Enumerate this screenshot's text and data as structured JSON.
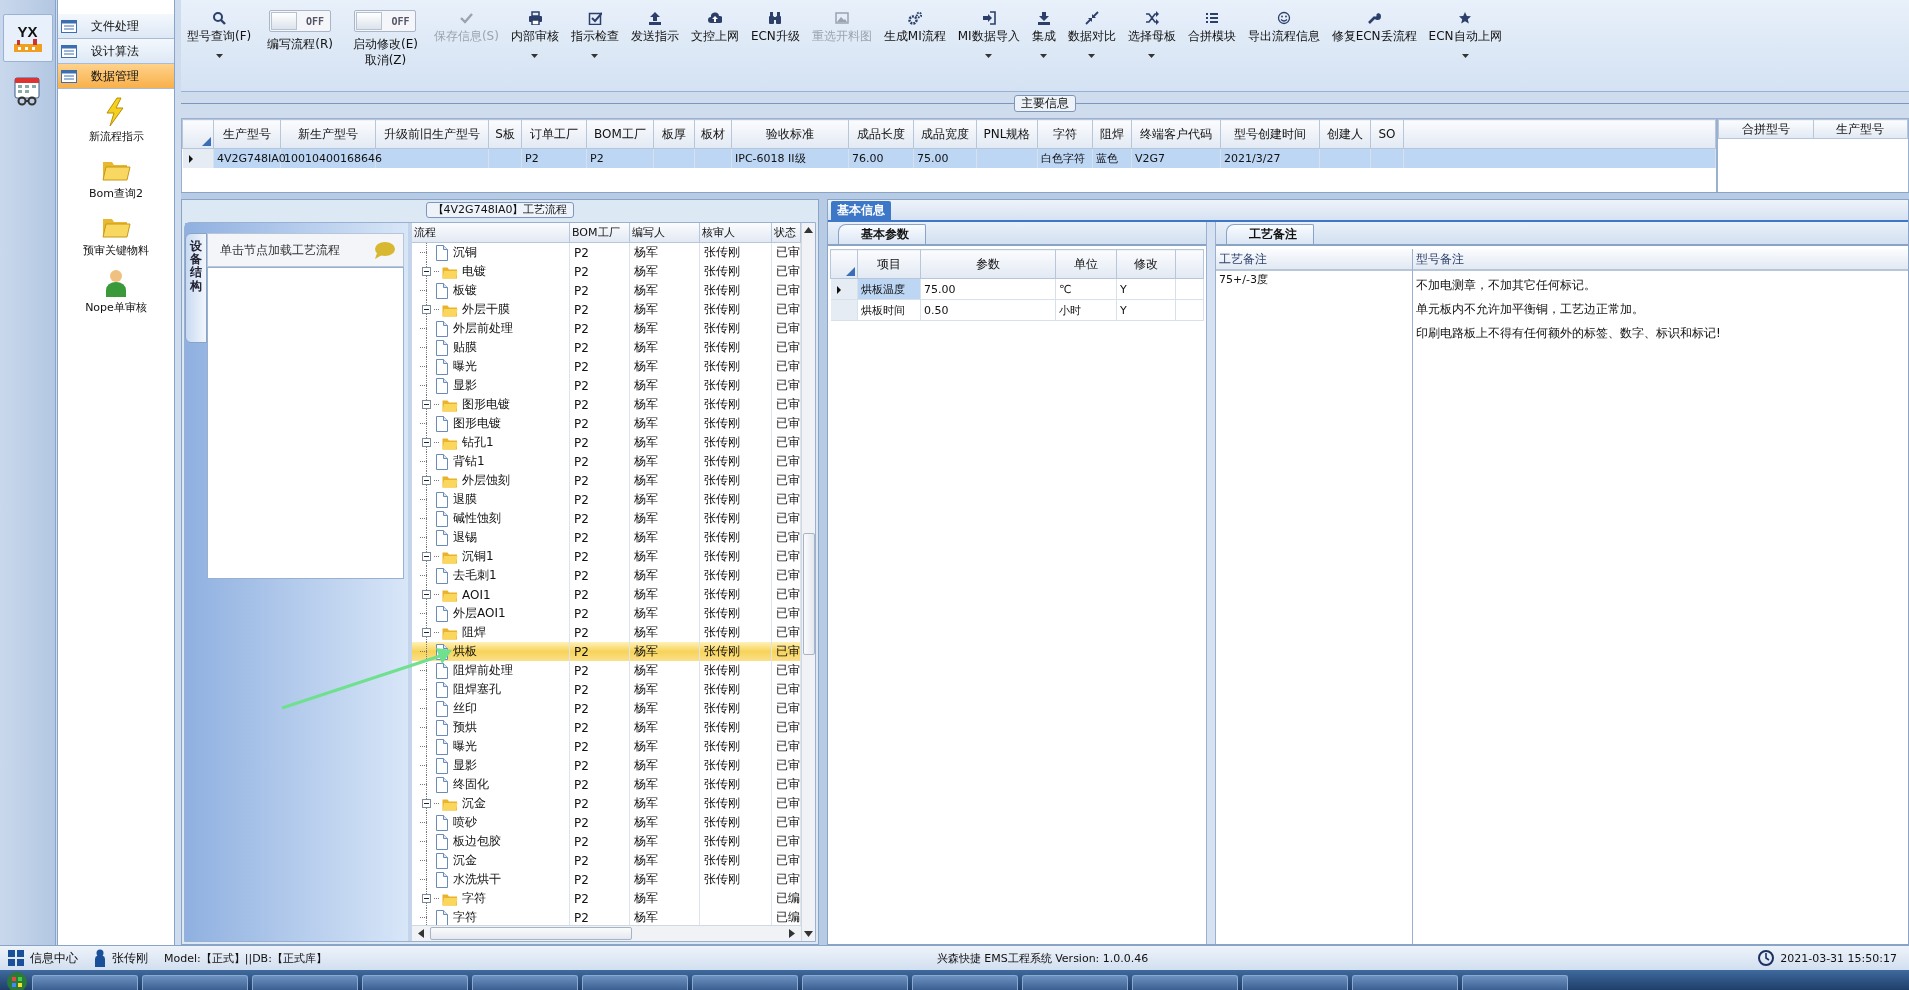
{
  "rail": [
    {
      "kind": "logo",
      "text": "YX",
      "selected": true
    },
    {
      "kind": "calendar",
      "selected": false
    }
  ],
  "nav": {
    "items": [
      {
        "label": "文件处理",
        "selected": false
      },
      {
        "label": "设计算法",
        "selected": false
      },
      {
        "label": "数据管理",
        "selected": true
      }
    ],
    "shortcuts": [
      {
        "label": "新流程指示"
      },
      {
        "label": "Bom查询2"
      },
      {
        "label": "预审关键物料"
      },
      {
        "label": "Nope单审核"
      }
    ]
  },
  "toolbar": [
    {
      "kind": "button",
      "label": "型号查询(F)",
      "dropdown": true,
      "disabled": false
    },
    {
      "kind": "toggle",
      "state_text": "OFF",
      "on": false,
      "label": "编写流程(R)"
    },
    {
      "kind": "toggle",
      "state_text": "OFF",
      "on": false,
      "label": "启动修改(E)",
      "label_2": "取消(Z)"
    },
    {
      "kind": "button",
      "label": "保存信息(S)",
      "dropdown": false,
      "disabled": true
    },
    {
      "kind": "button",
      "label": "内部审核",
      "dropdown": true,
      "disabled": false
    },
    {
      "kind": "button",
      "label": "指示检查",
      "dropdown": true,
      "disabled": false
    },
    {
      "kind": "button",
      "label": "发送指示",
      "dropdown": false,
      "disabled": false
    },
    {
      "kind": "button",
      "label": "文控上网",
      "dropdown": false,
      "disabled": false
    },
    {
      "kind": "button",
      "label": "ECN升级",
      "dropdown": false,
      "disabled": false
    },
    {
      "kind": "button",
      "label": "重选开料图",
      "dropdown": false,
      "disabled": true
    },
    {
      "kind": "button",
      "label": "生成MI流程",
      "dropdown": false,
      "disabled": false
    },
    {
      "kind": "button",
      "label": "MI数据导入",
      "dropdown": true,
      "disabled": false
    },
    {
      "kind": "button",
      "label": "集成",
      "dropdown": true,
      "disabled": false
    },
    {
      "kind": "button",
      "label": "数据对比",
      "dropdown": true,
      "disabled": false
    },
    {
      "kind": "button",
      "label": "选择母板",
      "dropdown": true,
      "disabled": false
    },
    {
      "kind": "button",
      "label": "合拼模块",
      "dropdown": false,
      "disabled": false
    },
    {
      "kind": "button",
      "label": "导出流程信息",
      "dropdown": false,
      "disabled": false
    },
    {
      "kind": "button",
      "label": "修复ECN丢流程",
      "dropdown": false,
      "disabled": false
    },
    {
      "kind": "button",
      "label": "ECN自动上网",
      "dropdown": true,
      "disabled": false
    }
  ],
  "main_info": {
    "title": "主要信息",
    "columns": [
      "生产型号",
      "新生产型号",
      "升级前旧生产型号",
      "S板",
      "订单工厂",
      "BOM工厂",
      "板厚",
      "板材",
      "验收标准",
      "成品长度",
      "成品宽度",
      "PNL规格",
      "字符",
      "阻焊",
      "终端客户代码",
      "型号创建时间",
      "创建人",
      "SO"
    ],
    "rows": [
      {
        "selected": true,
        "cells": [
          "4V2G748IA0",
          "10010400168646",
          null,
          null,
          "P2",
          "P2",
          null,
          null,
          "IPC-6018 II级",
          "76.00",
          "75.00",
          null,
          "白色字符",
          "蓝色",
          "V2G7",
          "2021/3/27",
          null,
          null
        ]
      }
    ],
    "merge_columns": [
      "合拼型号",
      "生产型号"
    ]
  },
  "process": {
    "title": "【4V2G748IA0】工艺流程",
    "side_tab": "设备结构",
    "hint": "单击节点加载工艺流程",
    "columns": [
      "流程",
      "BOM工厂",
      "编写人",
      "核审人",
      "状态"
    ],
    "tree": [
      {
        "kind": "file",
        "label": "沉铜",
        "bom": "P2",
        "writer": "杨军",
        "reviewer": "张传刚",
        "status": "已审",
        "selected": false
      },
      {
        "kind": "folder",
        "label": "电镀",
        "bom": "P2",
        "writer": "杨军",
        "reviewer": "张传刚",
        "status": "已审",
        "selected": false,
        "expanded": true,
        "children": [
          {
            "kind": "file",
            "label": "板镀",
            "bom": "P2",
            "writer": "杨军",
            "reviewer": "张传刚",
            "status": "已审",
            "selected": false
          }
        ]
      },
      {
        "kind": "folder",
        "label": "外层干膜",
        "bom": "P2",
        "writer": "杨军",
        "reviewer": "张传刚",
        "status": "已审",
        "selected": false,
        "expanded": true,
        "children": [
          {
            "kind": "file",
            "label": "外层前处理",
            "bom": "P2",
            "writer": "杨军",
            "reviewer": "张传刚",
            "status": "已审",
            "selected": false
          },
          {
            "kind": "file",
            "label": "贴膜",
            "bom": "P2",
            "writer": "杨军",
            "reviewer": "张传刚",
            "status": "已审",
            "selected": false
          },
          {
            "kind": "file",
            "label": "曝光",
            "bom": "P2",
            "writer": "杨军",
            "reviewer": "张传刚",
            "status": "已审",
            "selected": false
          },
          {
            "kind": "file",
            "label": "显影",
            "bom": "P2",
            "writer": "杨军",
            "reviewer": "张传刚",
            "status": "已审",
            "selected": false
          }
        ]
      },
      {
        "kind": "folder",
        "label": "图形电镀",
        "bom": "P2",
        "writer": "杨军",
        "reviewer": "张传刚",
        "status": "已审",
        "selected": false,
        "expanded": true,
        "children": [
          {
            "kind": "file",
            "label": "图形电镀",
            "bom": "P2",
            "writer": "杨军",
            "reviewer": "张传刚",
            "status": "已审",
            "selected": false
          }
        ]
      },
      {
        "kind": "folder",
        "label": "钻孔1",
        "bom": "P2",
        "writer": "杨军",
        "reviewer": "张传刚",
        "status": "已审",
        "selected": false,
        "expanded": true,
        "children": [
          {
            "kind": "file",
            "label": "背钻1",
            "bom": "P2",
            "writer": "杨军",
            "reviewer": "张传刚",
            "status": "已审",
            "selected": false
          }
        ]
      },
      {
        "kind": "folder",
        "label": "外层蚀刻",
        "bom": "P2",
        "writer": "杨军",
        "reviewer": "张传刚",
        "status": "已审",
        "selected": false,
        "expanded": true,
        "children": [
          {
            "kind": "file",
            "label": "退膜",
            "bom": "P2",
            "writer": "杨军",
            "reviewer": "张传刚",
            "status": "已审",
            "selected": false
          },
          {
            "kind": "file",
            "label": "碱性蚀刻",
            "bom": "P2",
            "writer": "杨军",
            "reviewer": "张传刚",
            "status": "已审",
            "selected": false
          },
          {
            "kind": "file",
            "label": "退锡",
            "bom": "P2",
            "writer": "杨军",
            "reviewer": "张传刚",
            "status": "已审",
            "selected": false
          }
        ]
      },
      {
        "kind": "folder",
        "label": "沉铜1",
        "bom": "P2",
        "writer": "杨军",
        "reviewer": "张传刚",
        "status": "已审",
        "selected": false,
        "expanded": true,
        "children": [
          {
            "kind": "file",
            "label": "去毛刺1",
            "bom": "P2",
            "writer": "杨军",
            "reviewer": "张传刚",
            "status": "已审",
            "selected": false
          }
        ]
      },
      {
        "kind": "folder",
        "label": "AOI1",
        "bom": "P2",
        "writer": "杨军",
        "reviewer": "张传刚",
        "status": "已审",
        "selected": false,
        "expanded": true,
        "children": [
          {
            "kind": "file",
            "label": "外层AOI1",
            "bom": "P2",
            "writer": "杨军",
            "reviewer": "张传刚",
            "status": "已审",
            "selected": false
          }
        ]
      },
      {
        "kind": "folder",
        "label": "阻焊",
        "bom": "P2",
        "writer": "杨军",
        "reviewer": "张传刚",
        "status": "已审",
        "selected": false,
        "expanded": true,
        "children": [
          {
            "kind": "file",
            "label": "烘板",
            "bom": "P2",
            "writer": "杨军",
            "reviewer": "张传刚",
            "status": "已审",
            "selected": true
          },
          {
            "kind": "file",
            "label": "阻焊前处理",
            "bom": "P2",
            "writer": "杨军",
            "reviewer": "张传刚",
            "status": "已审",
            "selected": false
          },
          {
            "kind": "file",
            "label": "阻焊塞孔",
            "bom": "P2",
            "writer": "杨军",
            "reviewer": "张传刚",
            "status": "已审",
            "selected": false
          },
          {
            "kind": "file",
            "label": "丝印",
            "bom": "P2",
            "writer": "杨军",
            "reviewer": "张传刚",
            "status": "已审",
            "selected": false
          },
          {
            "kind": "file",
            "label": "预烘",
            "bom": "P2",
            "writer": "杨军",
            "reviewer": "张传刚",
            "status": "已审",
            "selected": false
          },
          {
            "kind": "file",
            "label": "曝光",
            "bom": "P2",
            "writer": "杨军",
            "reviewer": "张传刚",
            "status": "已审",
            "selected": false
          },
          {
            "kind": "file",
            "label": "显影",
            "bom": "P2",
            "writer": "杨军",
            "reviewer": "张传刚",
            "status": "已审",
            "selected": false
          },
          {
            "kind": "file",
            "label": "终固化",
            "bom": "P2",
            "writer": "杨军",
            "reviewer": "张传刚",
            "status": "已审",
            "selected": false
          }
        ]
      },
      {
        "kind": "folder",
        "label": "沉金",
        "bom": "P2",
        "writer": "杨军",
        "reviewer": "张传刚",
        "status": "已审",
        "selected": false,
        "expanded": true,
        "children": [
          {
            "kind": "file",
            "label": "喷砂",
            "bom": "P2",
            "writer": "杨军",
            "reviewer": "张传刚",
            "status": "已审",
            "selected": false
          },
          {
            "kind": "file",
            "label": "板边包胶",
            "bom": "P2",
            "writer": "杨军",
            "reviewer": "张传刚",
            "status": "已审",
            "selected": false
          },
          {
            "kind": "file",
            "label": "沉金",
            "bom": "P2",
            "writer": "杨军",
            "reviewer": "张传刚",
            "status": "已审",
            "selected": false
          },
          {
            "kind": "file",
            "label": "水洗烘干",
            "bom": "P2",
            "writer": "杨军",
            "reviewer": "张传刚",
            "status": "已审",
            "selected": false
          }
        ]
      },
      {
        "kind": "folder",
        "label": "字符",
        "bom": "P2",
        "writer": "杨军",
        "status": "已编",
        "selected": false,
        "expanded": true,
        "children": [
          {
            "kind": "file",
            "label": "字符",
            "bom": "P2",
            "writer": "杨军",
            "status": "已编",
            "selected": false
          }
        ]
      }
    ]
  },
  "basic_info": {
    "tab": "基本信息",
    "params": {
      "tab": "基本参数",
      "columns": [
        "项目",
        "参数",
        "单位",
        "修改"
      ],
      "rows": [
        {
          "selected": true,
          "cells": [
            "烘板温度",
            "75.00",
            "℃",
            "Y"
          ]
        },
        {
          "selected": false,
          "cells": [
            "烘板时间",
            "0.50",
            "小时",
            "Y"
          ]
        }
      ]
    },
    "notes": {
      "tab": "工艺备注",
      "columns": [
        "工艺备注",
        "型号备注"
      ],
      "process_note": "75+/-3度",
      "model_notes": [
        "不加电测章，不加其它任何标记。",
        "单元板内不允许加平衡铜，工艺边正常加。",
        "印刷电路板上不得有任何额外的标签、数字、标识和标记!"
      ]
    }
  },
  "status_bar": {
    "info_center": "信息中心",
    "user": "张传刚",
    "model": "Model:【正式】||DB:【正式库】",
    "system": "兴森快捷 EMS工程系统 Version: 1.0.0.46",
    "time": "2021-03-31 15:50:17"
  }
}
